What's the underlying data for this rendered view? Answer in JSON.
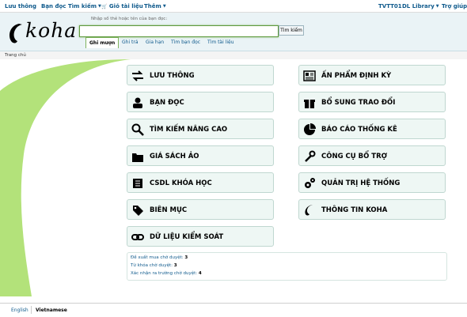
{
  "topnav": {
    "left_items": [
      "Lưu thông",
      "Bạn đọc",
      "Tìm kiếm",
      "Giỏ tài liệu",
      "Thêm"
    ],
    "right_items": [
      "TVTT01",
      "DL Library",
      "Trợ giúp"
    ]
  },
  "header": {
    "logo_text": "koha",
    "search_hint": "Nhập số thẻ hoặc tên của bạn đọc:",
    "search_value": "",
    "search_button": "Tìm kiếm",
    "tabs": [
      "Ghi mượn",
      "Ghi trả",
      "Gia hạn",
      "Tìm bạn đọc",
      "Tìm tài liệu"
    ]
  },
  "breadcrumb": "Trang chủ",
  "modules": {
    "left": [
      "LƯU THÔNG",
      "BẠN ĐỌC",
      "TÌM KIẾM NÂNG CAO",
      "GIÁ SÁCH ẢO",
      "CSDL KHÓA HỌC",
      "BIÊN MỤC",
      "DỮ LIỆU KIỂM SOÁT"
    ],
    "right": [
      "ẤN PHẨM ĐỊNH KỲ",
      "BỔ SUNG TRAO ĐỔI",
      "BÁO CÁO THỐNG KÊ",
      "CÔNG CỤ BỔ TRỢ",
      "QUẢN TRỊ HỆ THỐNG",
      "THÔNG TIN KOHA"
    ]
  },
  "pending": [
    {
      "label": "Đề xuất mua chờ duyệt:",
      "count": "3"
    },
    {
      "label": "Từ khóa chờ duyệt:",
      "count": "3"
    },
    {
      "label": "Xác nhận ra trường chờ duyệt:",
      "count": "4"
    }
  ],
  "footer": {
    "languages": [
      "English",
      "Vietnamese"
    ]
  },
  "colors": {
    "accent": "#0f5a8c",
    "leaf": "#b3e27a",
    "card_bg": "#eef7f4"
  }
}
